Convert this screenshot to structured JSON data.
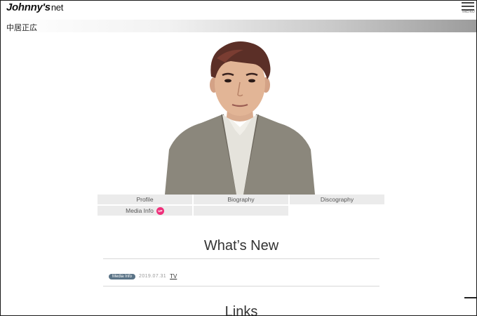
{
  "header": {
    "logo_main": "Johnny's",
    "logo_suffix": "net",
    "menu_label": "MENU"
  },
  "artist": {
    "name": "中居正広"
  },
  "nav": {
    "items": [
      {
        "label": "Profile"
      },
      {
        "label": "Biography"
      },
      {
        "label": "Discography"
      },
      {
        "label": "Media Info",
        "badge": "UP"
      }
    ]
  },
  "whats_new": {
    "title": "What’s New",
    "items": [
      {
        "category": "Media Info",
        "date": "2019.07.31",
        "link": "TV"
      }
    ]
  },
  "links": {
    "title": "Links"
  },
  "colors": {
    "badge_up": "#ee2f7a",
    "news_badge": "#5a7386",
    "nav_cell": "#ebebeb"
  }
}
